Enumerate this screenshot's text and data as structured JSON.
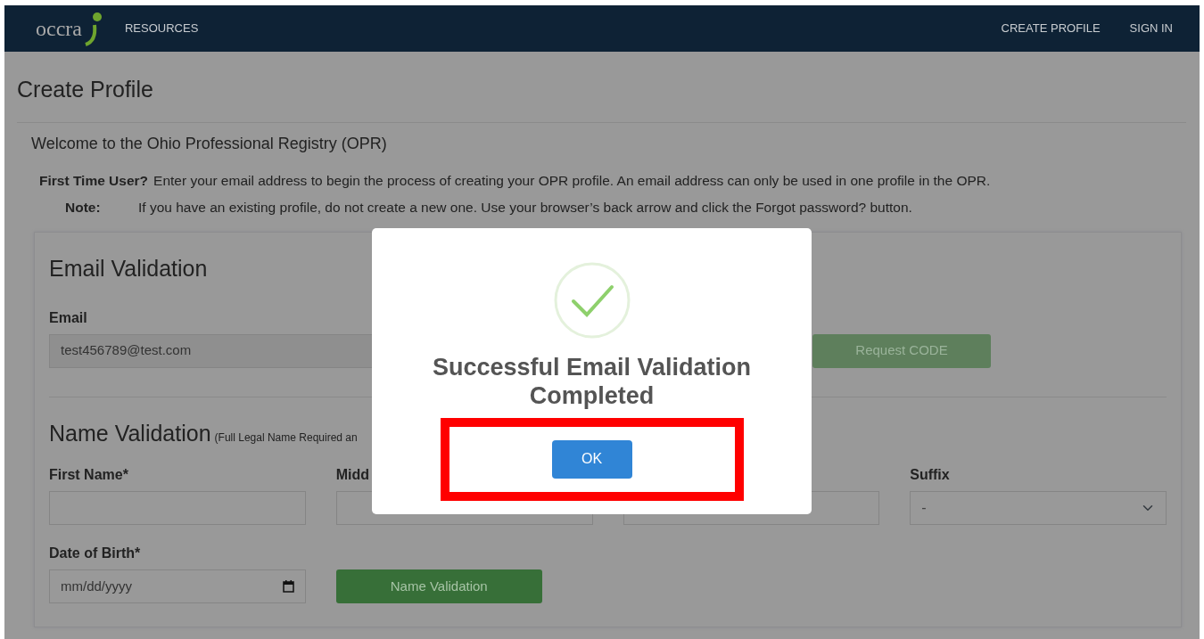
{
  "navbar": {
    "logo": "occra",
    "left_links": [
      "RESOURCES"
    ],
    "right_links": [
      "CREATE PROFILE",
      "SIGN IN"
    ]
  },
  "page_title": "Create Profile",
  "welcome": "Welcome to the Ohio Professional Registry (OPR)",
  "intro": [
    {
      "label": "First Time User?",
      "text": "Enter your email address to begin the process of creating your OPR profile. An email address can only be used in one profile in the OPR."
    },
    {
      "label": "Note:",
      "text": "If you have an existing profile, do not create a new one. Use your browser’s back arrow and click the Forgot password? button."
    }
  ],
  "email_section": {
    "title": "Email Validation",
    "label": "Email",
    "value": "test456789@test.com",
    "button": "Request CODE"
  },
  "name_section": {
    "title": "Name Validation",
    "note": "(Full Legal Name Required an",
    "fields": [
      {
        "kind": "text",
        "label": "First Name*"
      },
      {
        "kind": "text",
        "label": "Midd"
      },
      {
        "kind": "text"
      },
      {
        "kind": "select",
        "label": "Suffix",
        "value": "-"
      }
    ],
    "dob": {
      "label": "Date of Birth*",
      "placeholder": "mm/dd/yyyy"
    },
    "button": "Name Validation"
  },
  "modal": {
    "title": "Successful Email Validation Completed",
    "button": "OK",
    "highlighted": true
  }
}
